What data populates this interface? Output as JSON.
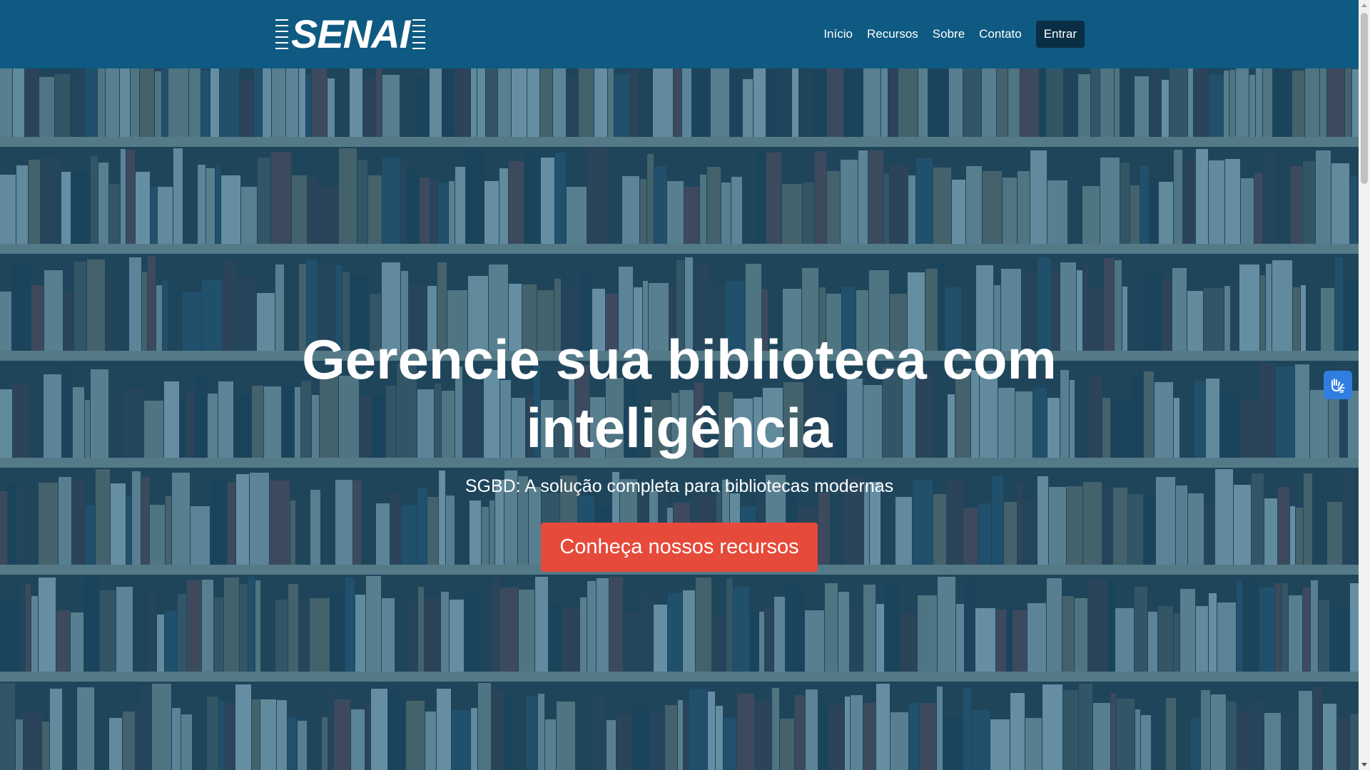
{
  "header": {
    "logo_text": "SENAI",
    "nav": {
      "inicio": "Início",
      "recursos": "Recursos",
      "sobre": "Sobre",
      "contato": "Contato",
      "entrar": "Entrar"
    }
  },
  "hero": {
    "title": "Gerencie sua biblioteca com inteligência",
    "subtitle": "SGBD: A solução completa para bibliotecas modernas",
    "cta_label": "Conheça nossos recursos",
    "background": "library-bookshelves-photo"
  },
  "widgets": {
    "accessibility_icon": "sign-language-hands-icon"
  },
  "colors": {
    "header_bg": "#0e5a82",
    "overlay": "#0e547c",
    "cta": "#e64a3b",
    "login_button": "#0a2f45",
    "accessibility_widget": "#2f7de1"
  }
}
